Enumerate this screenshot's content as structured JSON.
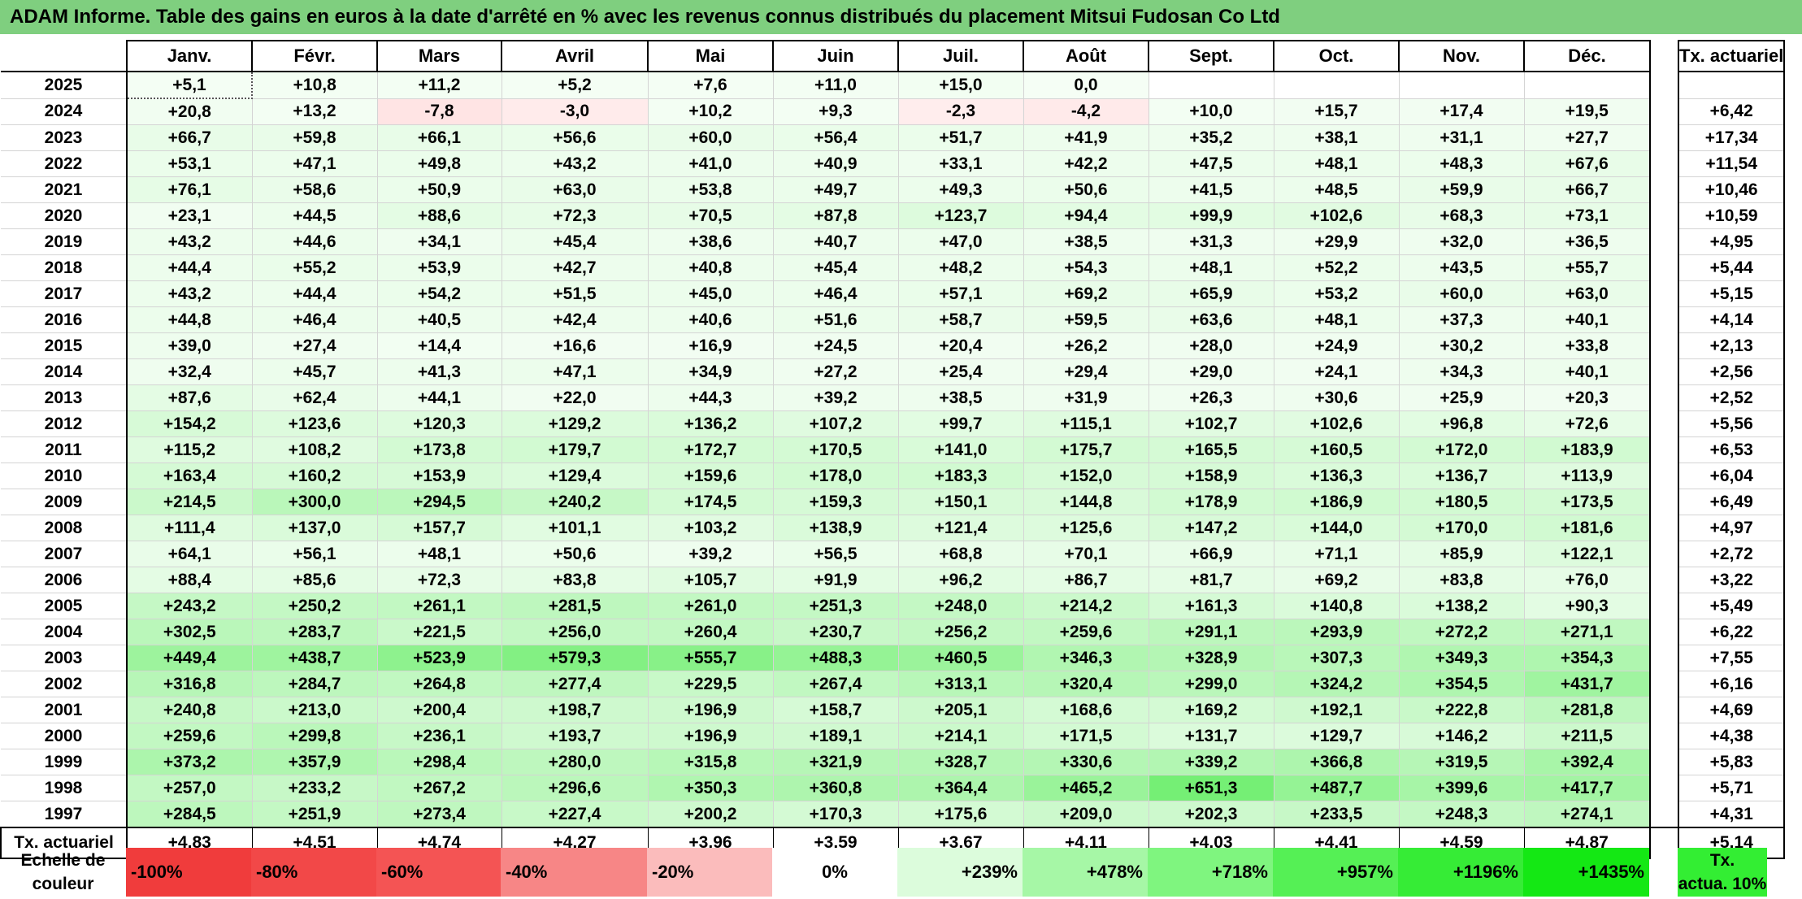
{
  "title": "ADAM Informe. Table des gains en euros à la date d'arrêté en % avec les revenus connus distribués du placement Mitsui Fudosan Co Ltd",
  "months": [
    "Janv.",
    "Févr.",
    "Mars",
    "Avril",
    "Mai",
    "Juin",
    "Juil.",
    "Août",
    "Sept.",
    "Oct.",
    "Nov.",
    "Déc."
  ],
  "actuarial_header": "Tx. actuariel",
  "rows": [
    {
      "year": "2025",
      "values": [
        "+5,1",
        "+10,8",
        "+11,2",
        "+5,2",
        "+7,6",
        "+11,0",
        "+15,0",
        "0,0",
        "",
        "",
        "",
        ""
      ],
      "rate": ""
    },
    {
      "year": "2024",
      "values": [
        "+20,8",
        "+13,2",
        "-7,8",
        "-3,0",
        "+10,2",
        "+9,3",
        "-2,3",
        "-4,2",
        "+10,0",
        "+15,7",
        "+17,4",
        "+19,5"
      ],
      "rate": "+6,42"
    },
    {
      "year": "2023",
      "values": [
        "+66,7",
        "+59,8",
        "+66,1",
        "+56,6",
        "+60,0",
        "+56,4",
        "+51,7",
        "+41,9",
        "+35,2",
        "+38,1",
        "+31,1",
        "+27,7"
      ],
      "rate": "+17,34"
    },
    {
      "year": "2022",
      "values": [
        "+53,1",
        "+47,1",
        "+49,8",
        "+43,2",
        "+41,0",
        "+40,9",
        "+33,1",
        "+42,2",
        "+47,5",
        "+48,1",
        "+48,3",
        "+67,6"
      ],
      "rate": "+11,54"
    },
    {
      "year": "2021",
      "values": [
        "+76,1",
        "+58,6",
        "+50,9",
        "+63,0",
        "+53,8",
        "+49,7",
        "+49,3",
        "+50,6",
        "+41,5",
        "+48,5",
        "+59,9",
        "+66,7"
      ],
      "rate": "+10,46"
    },
    {
      "year": "2020",
      "values": [
        "+23,1",
        "+44,5",
        "+88,6",
        "+72,3",
        "+70,5",
        "+87,8",
        "+123,7",
        "+94,4",
        "+99,9",
        "+102,6",
        "+68,3",
        "+73,1"
      ],
      "rate": "+10,59"
    },
    {
      "year": "2019",
      "values": [
        "+43,2",
        "+44,6",
        "+34,1",
        "+45,4",
        "+38,6",
        "+40,7",
        "+47,0",
        "+38,5",
        "+31,3",
        "+29,9",
        "+32,0",
        "+36,5"
      ],
      "rate": "+4,95"
    },
    {
      "year": "2018",
      "values": [
        "+44,4",
        "+55,2",
        "+53,9",
        "+42,7",
        "+40,8",
        "+45,4",
        "+48,2",
        "+54,3",
        "+48,1",
        "+52,2",
        "+43,5",
        "+55,7"
      ],
      "rate": "+5,44"
    },
    {
      "year": "2017",
      "values": [
        "+43,2",
        "+44,4",
        "+54,2",
        "+51,5",
        "+45,0",
        "+46,4",
        "+57,1",
        "+69,2",
        "+65,9",
        "+53,2",
        "+60,0",
        "+63,0"
      ],
      "rate": "+5,15"
    },
    {
      "year": "2016",
      "values": [
        "+44,8",
        "+46,4",
        "+40,5",
        "+42,4",
        "+40,6",
        "+51,6",
        "+58,7",
        "+59,5",
        "+63,6",
        "+48,1",
        "+37,3",
        "+40,1"
      ],
      "rate": "+4,14"
    },
    {
      "year": "2015",
      "values": [
        "+39,0",
        "+27,4",
        "+14,4",
        "+16,6",
        "+16,9",
        "+24,5",
        "+20,4",
        "+26,2",
        "+28,0",
        "+24,9",
        "+30,2",
        "+33,8"
      ],
      "rate": "+2,13"
    },
    {
      "year": "2014",
      "values": [
        "+32,4",
        "+45,7",
        "+41,3",
        "+47,1",
        "+34,9",
        "+27,2",
        "+25,4",
        "+29,4",
        "+29,0",
        "+24,1",
        "+34,3",
        "+40,1"
      ],
      "rate": "+2,56"
    },
    {
      "year": "2013",
      "values": [
        "+87,6",
        "+62,4",
        "+44,1",
        "+22,0",
        "+44,3",
        "+39,2",
        "+38,5",
        "+31,9",
        "+26,3",
        "+30,6",
        "+25,9",
        "+20,3"
      ],
      "rate": "+2,52"
    },
    {
      "year": "2012",
      "values": [
        "+154,2",
        "+123,6",
        "+120,3",
        "+129,2",
        "+136,2",
        "+107,2",
        "+99,7",
        "+115,1",
        "+102,7",
        "+102,6",
        "+96,8",
        "+72,6"
      ],
      "rate": "+5,56"
    },
    {
      "year": "2011",
      "values": [
        "+115,2",
        "+108,2",
        "+173,8",
        "+179,7",
        "+172,7",
        "+170,5",
        "+141,0",
        "+175,7",
        "+165,5",
        "+160,5",
        "+172,0",
        "+183,9"
      ],
      "rate": "+6,53"
    },
    {
      "year": "2010",
      "values": [
        "+163,4",
        "+160,2",
        "+153,9",
        "+129,4",
        "+159,6",
        "+178,0",
        "+183,3",
        "+152,0",
        "+158,9",
        "+136,3",
        "+136,7",
        "+113,9"
      ],
      "rate": "+6,04"
    },
    {
      "year": "2009",
      "values": [
        "+214,5",
        "+300,0",
        "+294,5",
        "+240,2",
        "+174,5",
        "+159,3",
        "+150,1",
        "+144,8",
        "+178,9",
        "+186,9",
        "+180,5",
        "+173,5"
      ],
      "rate": "+6,49"
    },
    {
      "year": "2008",
      "values": [
        "+111,4",
        "+137,0",
        "+157,7",
        "+101,1",
        "+103,2",
        "+138,9",
        "+121,4",
        "+125,6",
        "+147,2",
        "+144,0",
        "+170,0",
        "+181,6"
      ],
      "rate": "+4,97"
    },
    {
      "year": "2007",
      "values": [
        "+64,1",
        "+56,1",
        "+48,1",
        "+50,6",
        "+39,2",
        "+56,5",
        "+68,8",
        "+70,1",
        "+66,9",
        "+71,1",
        "+85,9",
        "+122,1"
      ],
      "rate": "+2,72"
    },
    {
      "year": "2006",
      "values": [
        "+88,4",
        "+85,6",
        "+72,3",
        "+83,8",
        "+105,7",
        "+91,9",
        "+96,2",
        "+86,7",
        "+81,7",
        "+69,2",
        "+83,8",
        "+76,0"
      ],
      "rate": "+3,22"
    },
    {
      "year": "2005",
      "values": [
        "+243,2",
        "+250,2",
        "+261,1",
        "+281,5",
        "+261,0",
        "+251,3",
        "+248,0",
        "+214,2",
        "+161,3",
        "+140,8",
        "+138,2",
        "+90,3"
      ],
      "rate": "+5,49"
    },
    {
      "year": "2004",
      "values": [
        "+302,5",
        "+283,7",
        "+221,5",
        "+256,0",
        "+260,4",
        "+230,7",
        "+256,2",
        "+259,6",
        "+291,1",
        "+293,9",
        "+272,2",
        "+271,1"
      ],
      "rate": "+6,22"
    },
    {
      "year": "2003",
      "values": [
        "+449,4",
        "+438,7",
        "+523,9",
        "+579,3",
        "+555,7",
        "+488,3",
        "+460,5",
        "+346,3",
        "+328,9",
        "+307,3",
        "+349,3",
        "+354,3"
      ],
      "rate": "+7,55"
    },
    {
      "year": "2002",
      "values": [
        "+316,8",
        "+284,7",
        "+264,8",
        "+277,4",
        "+229,5",
        "+267,4",
        "+313,1",
        "+320,4",
        "+299,0",
        "+324,2",
        "+354,5",
        "+431,7"
      ],
      "rate": "+6,16"
    },
    {
      "year": "2001",
      "values": [
        "+240,8",
        "+213,0",
        "+200,4",
        "+198,7",
        "+196,9",
        "+158,7",
        "+205,1",
        "+168,6",
        "+169,2",
        "+192,1",
        "+222,8",
        "+281,8"
      ],
      "rate": "+4,69"
    },
    {
      "year": "2000",
      "values": [
        "+259,6",
        "+299,8",
        "+236,1",
        "+193,7",
        "+196,9",
        "+189,1",
        "+214,1",
        "+171,5",
        "+131,7",
        "+129,7",
        "+146,2",
        "+211,5"
      ],
      "rate": "+4,38"
    },
    {
      "year": "1999",
      "values": [
        "+373,2",
        "+357,9",
        "+298,4",
        "+280,0",
        "+315,8",
        "+321,9",
        "+328,7",
        "+330,6",
        "+339,2",
        "+366,8",
        "+319,5",
        "+392,4"
      ],
      "rate": "+5,83"
    },
    {
      "year": "1998",
      "values": [
        "+257,0",
        "+233,2",
        "+267,2",
        "+296,6",
        "+350,3",
        "+360,8",
        "+364,4",
        "+465,2",
        "+651,3",
        "+487,7",
        "+399,6",
        "+417,7"
      ],
      "rate": "+5,71"
    },
    {
      "year": "1997",
      "values": [
        "+284,5",
        "+251,9",
        "+273,4",
        "+227,4",
        "+200,2",
        "+170,3",
        "+175,6",
        "+209,0",
        "+202,3",
        "+233,5",
        "+248,3",
        "+274,1"
      ],
      "rate": "+4,31"
    }
  ],
  "footer": {
    "label": "Tx. actuariel",
    "values": [
      "+4,83",
      "+4,51",
      "+4,74",
      "+4,27",
      "+3,96",
      "+3,59",
      "+3,67",
      "+4,11",
      "+4,03",
      "+4,41",
      "+4,59",
      "+4,87"
    ],
    "overall": "+5,14"
  },
  "color_scale": {
    "label_line1": "Echelle de",
    "label_line2": "couleur",
    "steps": [
      {
        "label": "-100%",
        "color": "#f03c3c"
      },
      {
        "label": "-80%",
        "color": "#f24848"
      },
      {
        "label": "-60%",
        "color": "#f45454"
      },
      {
        "label": "-40%",
        "color": "#f78686"
      },
      {
        "label": "-20%",
        "color": "#fbbcbc"
      },
      {
        "label": "0%",
        "color": "#ffffff"
      },
      {
        "label": "+239%",
        "color": "#dcfcdc"
      },
      {
        "label": "+478%",
        "color": "#a6f7a6"
      },
      {
        "label": "+718%",
        "color": "#7ff57f"
      },
      {
        "label": "+957%",
        "color": "#55f055"
      },
      {
        "label": "+1196%",
        "color": "#36ec36"
      },
      {
        "label": "+1435%",
        "color": "#14e814"
      }
    ],
    "actuarial_line1": "Tx.",
    "actuarial_line2": "actua. 10%"
  }
}
